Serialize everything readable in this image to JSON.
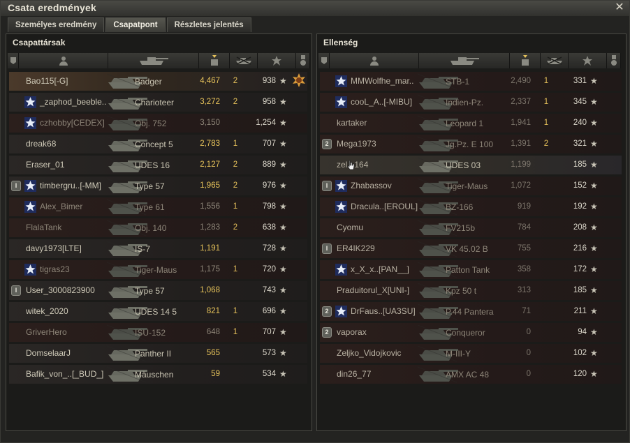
{
  "window": {
    "title": "Csata eredmények"
  },
  "tabs": [
    {
      "label": "Személyes eredmény"
    },
    {
      "label": "Csapatpont"
    },
    {
      "label": "Részletes jelentés"
    }
  ],
  "allies": {
    "title": "Csapattársak",
    "rows": [
      {
        "name": "Bao115[-G]",
        "tank": "Badger",
        "damage": "4,467",
        "kills": "2",
        "xp": "938",
        "badge": "",
        "clan": false,
        "state": "highlight",
        "medal": true
      },
      {
        "name": "_zaphod_beeble..",
        "tank": "Charioteer",
        "damage": "3,272",
        "kills": "2",
        "xp": "958",
        "badge": "",
        "clan": true,
        "state": "alive"
      },
      {
        "name": "czhobby[CEDEX]",
        "tank": "Obj. 752",
        "damage": "3,150",
        "kills": "",
        "xp": "1,254",
        "badge": "",
        "clan": true,
        "state": "dead"
      },
      {
        "name": "dreak68",
        "tank": "Concept 5",
        "damage": "2,783",
        "kills": "1",
        "xp": "707",
        "badge": "",
        "clan": false,
        "state": "alive"
      },
      {
        "name": "Eraser_01",
        "tank": "UDES 16",
        "damage": "2,127",
        "kills": "2",
        "xp": "889",
        "badge": "",
        "clan": false,
        "state": "alive"
      },
      {
        "name": "timbergru..[-MM]",
        "tank": "Type 57",
        "damage": "1,965",
        "kills": "2",
        "xp": "976",
        "badge": "I",
        "clan": true,
        "state": "alive"
      },
      {
        "name": "Alex_Bimer",
        "tank": "Type 61",
        "damage": "1,556",
        "kills": "1",
        "xp": "798",
        "badge": "",
        "clan": true,
        "state": "dead"
      },
      {
        "name": "FlalaTank",
        "tank": "Obj. 140",
        "damage": "1,283",
        "kills": "2",
        "xp": "638",
        "badge": "",
        "clan": false,
        "state": "dead"
      },
      {
        "name": "davy1973[LTE]",
        "tank": "IS-7",
        "damage": "1,191",
        "kills": "",
        "xp": "728",
        "badge": "",
        "clan": false,
        "state": "alive"
      },
      {
        "name": "tigras23",
        "tank": "Tiger-Maus",
        "damage": "1,175",
        "kills": "1",
        "xp": "720",
        "badge": "",
        "clan": true,
        "state": "dead"
      },
      {
        "name": "User_3000823900",
        "tank": "Type 57",
        "damage": "1,068",
        "kills": "",
        "xp": "743",
        "badge": "I",
        "clan": false,
        "state": "alive"
      },
      {
        "name": "witek_2020",
        "tank": "UDES 14 5",
        "damage": "821",
        "kills": "1",
        "xp": "696",
        "badge": "",
        "clan": false,
        "state": "alive"
      },
      {
        "name": "GriverHero",
        "tank": "ISU-152",
        "damage": "648",
        "kills": "1",
        "xp": "707",
        "badge": "",
        "clan": false,
        "state": "dead"
      },
      {
        "name": "DomselaarJ",
        "tank": "Panther II",
        "damage": "565",
        "kills": "",
        "xp": "573",
        "badge": "",
        "clan": false,
        "state": "alive"
      },
      {
        "name": "Bafik_von_..[_BUD_]",
        "tank": "Mäuschen",
        "damage": "59",
        "kills": "",
        "xp": "534",
        "badge": "",
        "clan": false,
        "state": "alive"
      }
    ]
  },
  "enemies": {
    "title": "Ellenség",
    "rows": [
      {
        "name": "MMWolfhe_mar..",
        "tank": "STB-1",
        "damage": "2,490",
        "kills": "1",
        "xp": "331",
        "badge": "",
        "clan": true,
        "state": "dead"
      },
      {
        "name": "cooL_A..[-MIBU]",
        "tank": "Indien-Pz.",
        "damage": "2,337",
        "kills": "1",
        "xp": "345",
        "badge": "",
        "clan": true,
        "state": "dead"
      },
      {
        "name": "kartaker",
        "tank": "Leopard 1",
        "damage": "1,941",
        "kills": "1",
        "xp": "240",
        "badge": "",
        "clan": false,
        "state": "dead"
      },
      {
        "name": "Mega1973",
        "tank": "Jg.Pz. E 100",
        "damage": "1,391",
        "kills": "2",
        "xp": "321",
        "badge": "2",
        "clan": false,
        "state": "dead"
      },
      {
        "name": "zel...164",
        "tank": "UDES 03",
        "damage": "1,199",
        "kills": "",
        "xp": "185",
        "badge": "",
        "clan": false,
        "state": "hover"
      },
      {
        "name": "Zhabassov",
        "tank": "Tiger-Maus",
        "damage": "1,072",
        "kills": "",
        "xp": "152",
        "badge": "I",
        "clan": true,
        "state": "dead"
      },
      {
        "name": "Dracula..[EROUL]",
        "tank": "BZ-166",
        "damage": "919",
        "kills": "",
        "xp": "192",
        "badge": "",
        "clan": true,
        "state": "dead"
      },
      {
        "name": "Cyomu",
        "tank": "FV215b",
        "damage": "784",
        "kills": "",
        "xp": "208",
        "badge": "",
        "clan": false,
        "state": "dead"
      },
      {
        "name": "ER4IK229",
        "tank": "VK 45.02 B",
        "damage": "755",
        "kills": "",
        "xp": "216",
        "badge": "I",
        "clan": false,
        "state": "dead"
      },
      {
        "name": "x_X_x..[PAN__]",
        "tank": "Patton Tank",
        "damage": "358",
        "kills": "",
        "xp": "172",
        "badge": "",
        "clan": true,
        "state": "dead"
      },
      {
        "name": "Praduitorul_X[UNI-]",
        "tank": "Kpz 50 t",
        "damage": "313",
        "kills": "",
        "xp": "185",
        "badge": "",
        "clan": false,
        "state": "dead"
      },
      {
        "name": "DrFaus..[UA3SU]",
        "tank": "P.44 Pantera",
        "damage": "71",
        "kills": "",
        "xp": "211",
        "badge": "2",
        "clan": true,
        "state": "dead"
      },
      {
        "name": "vaporax",
        "tank": "Conqueror",
        "damage": "0",
        "kills": "",
        "xp": "94",
        "badge": "2",
        "clan": false,
        "state": "dead"
      },
      {
        "name": "Zeljko_Vidojkovic",
        "tank": "M-III-Y",
        "damage": "0",
        "kills": "",
        "xp": "102",
        "badge": "",
        "clan": false,
        "state": "dead"
      },
      {
        "name": "din26_77",
        "tank": "AMX AC 48",
        "damage": "0",
        "kills": "",
        "xp": "120",
        "badge": "",
        "clan": false,
        "state": "dead"
      }
    ]
  },
  "icons": {
    "close": "close-icon",
    "star": "star-icon",
    "medal": "medal-icon",
    "platoon": "platoon-badge",
    "clan": "clan-emblem-icon"
  },
  "colors": {
    "damage": "#e6c25a",
    "highlight_row": "#4b3a2b",
    "dead_row": "#2b1f1c"
  }
}
